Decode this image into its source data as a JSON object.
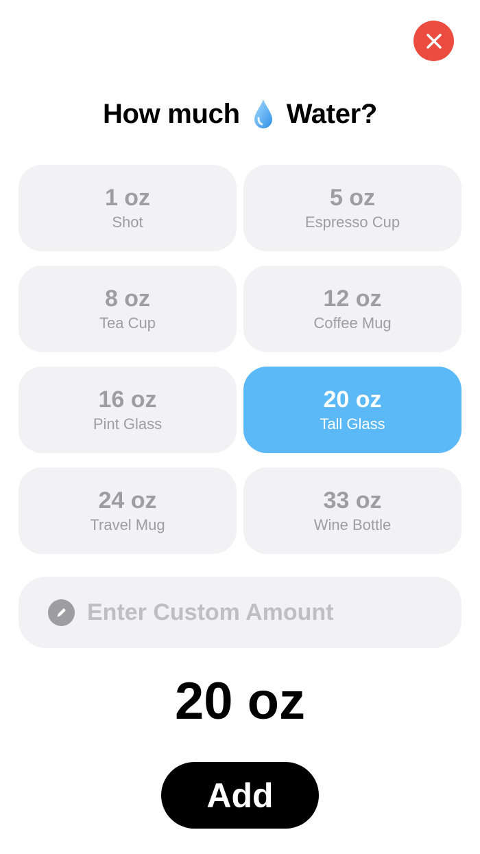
{
  "header": {
    "title_prefix": "How much",
    "title_suffix": "Water?",
    "drop_icon": "water-drop-icon",
    "close_icon": "close-icon"
  },
  "options": [
    {
      "amount": "1 oz",
      "label": "Shot",
      "selected": false
    },
    {
      "amount": "5 oz",
      "label": "Espresso Cup",
      "selected": false
    },
    {
      "amount": "8 oz",
      "label": "Tea Cup",
      "selected": false
    },
    {
      "amount": "12 oz",
      "label": "Coffee Mug",
      "selected": false
    },
    {
      "amount": "16 oz",
      "label": "Pint Glass",
      "selected": false
    },
    {
      "amount": "20 oz",
      "label": "Tall Glass",
      "selected": true
    },
    {
      "amount": "24 oz",
      "label": "Travel Mug",
      "selected": false
    },
    {
      "amount": "33 oz",
      "label": "Wine Bottle",
      "selected": false
    }
  ],
  "custom": {
    "placeholder": "Enter Custom Amount",
    "value": "",
    "icon": "pencil-icon"
  },
  "summary": {
    "total": "20 oz"
  },
  "actions": {
    "add_label": "Add"
  },
  "colors": {
    "close": "#ec4b3f",
    "selected": "#5bb9f7",
    "tile": "#f2f2f4",
    "muted_text": "#9d9da2",
    "add_button": "#000000"
  }
}
